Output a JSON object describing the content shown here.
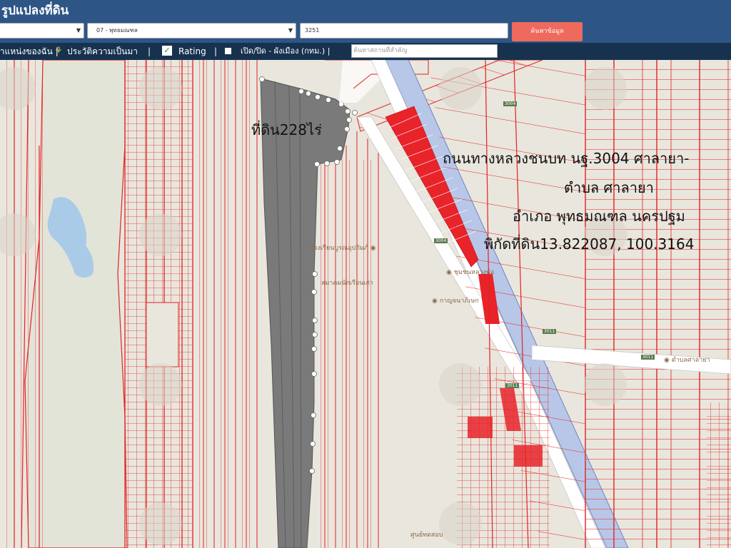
{
  "header": {
    "title": "รูปแปลงที่ดิน"
  },
  "search": {
    "province_value": "",
    "district_value": "07 - พุทธมณฑล",
    "parcel_value": "3251",
    "search_button": "ค้นหาข้อมูล"
  },
  "toolbar": {
    "my_location": "ตำแหน่งของฉัน |",
    "history": "ประวัติความเป็นมา",
    "rating": "Rating",
    "zoning": "เปิด/ปิด - ผังเมือง (กทม.) |",
    "place_placeholder": "ค้นหาสถานที่สำคัญ"
  },
  "map": {
    "parcel_label": "ที่ดิน228ไร่",
    "info_lines": [
      "ถนนทางหลวงชนบท นฐ.3004 ศาลายา-",
      "ตำบล ศาลายา",
      "อำเภอ พุทธมณฑล นครปฐม",
      "พิกัดที่ดิน13.822087, 100.3164"
    ],
    "pois": [
      "โรงเรียนบูรณอุปถัมภ์",
      "สมาคมนักเรียนเก่า",
      "กาญจนาภิเษก",
      "ชุมชนหลวงพ่อ",
      "ตำบลศาลายา",
      "ศูนย์ทดสอบ"
    ],
    "road_numbers": [
      "3004",
      "3004",
      "3011",
      "3011",
      "3011"
    ],
    "colors": {
      "parcel_line": "#e32222",
      "highlight": "#e8232a",
      "selected": "#7a7a7a",
      "water": "#a9cbe8",
      "road": "#ffffff",
      "canal": "#b8c7e8"
    }
  }
}
